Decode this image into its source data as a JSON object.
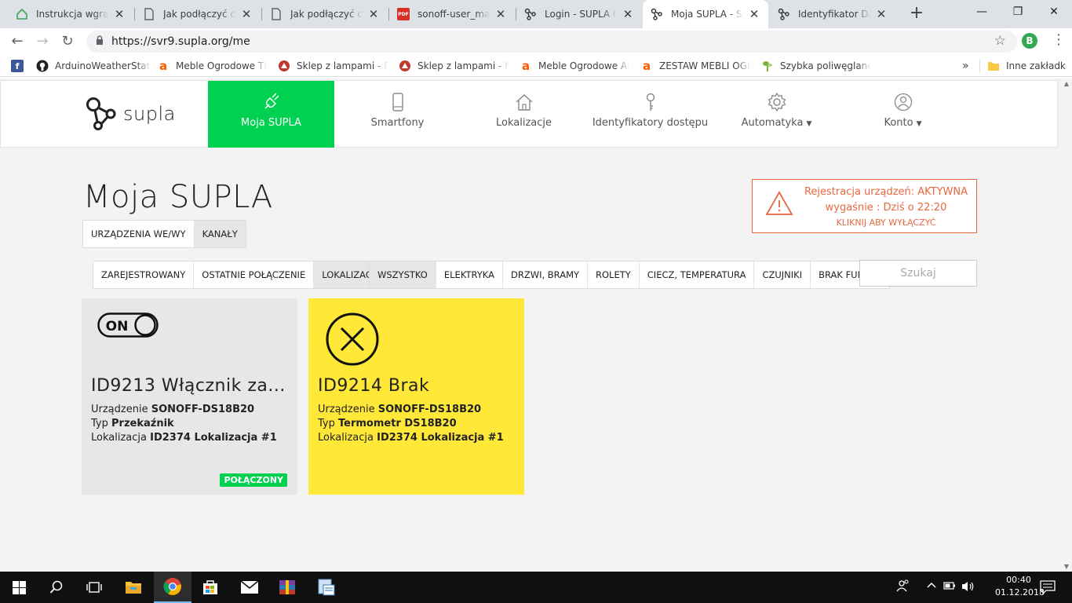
{
  "browser": {
    "tabs": [
      {
        "title": "Instrukcja wgrania",
        "icon": "house-icon"
      },
      {
        "title": "Jak podłączyć czuj",
        "icon": "page-icon"
      },
      {
        "title": "Jak podłączyć czuj",
        "icon": "page-icon"
      },
      {
        "title": "sonoff-user_manu",
        "icon": "pdf-icon"
      },
      {
        "title": "Login - SUPLA Clo",
        "icon": "supla-icon"
      },
      {
        "title": "Moja SUPLA - SUP",
        "icon": "supla-icon",
        "active": true
      },
      {
        "title": "Identyfikator Dost",
        "icon": "supla-icon"
      }
    ],
    "pdf_badge": "PDF",
    "url": "https://svr9.supla.org/me",
    "profile_initial": "B",
    "bookmarks": [
      {
        "title": "",
        "icon": "facebook-icon",
        "color": "#3b5998",
        "glyph": "f"
      },
      {
        "title": "ArduinoWeatherStati",
        "icon": "github-icon",
        "color": "#222",
        "glyph": ""
      },
      {
        "title": "Meble Ogrodowe TE",
        "icon": "allegro-icon",
        "color": "#ff5a00",
        "glyph": "a"
      },
      {
        "title": "Sklep z lampami - RE",
        "icon": "lamp-shop-icon",
        "color": "#c0392b",
        "glyph": ""
      },
      {
        "title": "Sklep z lampami - M",
        "icon": "lamp-shop-icon",
        "color": "#c0392b",
        "glyph": ""
      },
      {
        "title": "Meble Ogrodowe Alu",
        "icon": "allegro-icon",
        "color": "#ff5a00",
        "glyph": "a"
      },
      {
        "title": "ZESTAW MEBLI OGRO",
        "icon": "allegro-icon",
        "color": "#ff5a00",
        "glyph": "a"
      },
      {
        "title": "Szybka poliwęglanow",
        "icon": "plant-icon",
        "color": "#7cb342",
        "glyph": ""
      }
    ],
    "bookmarks_more": "»",
    "other_bookmarks": "Inne zakładki"
  },
  "app": {
    "brand": "supla",
    "nav": [
      {
        "label": "Moja SUPLA",
        "icon": "plug-icon",
        "active": true
      },
      {
        "label": "Smartfony",
        "icon": "smartphone-icon"
      },
      {
        "label": "Lokalizacje",
        "icon": "home-icon"
      },
      {
        "label": "Identyfikatory dostępu",
        "icon": "key-icon"
      },
      {
        "label": "Automatyka",
        "icon": "gear-icon",
        "dropdown": true
      },
      {
        "label": "Konto",
        "icon": "user-icon",
        "dropdown": true
      }
    ],
    "page_title": "Moja SUPLA",
    "view_tabs": [
      {
        "label": "URZĄDZENIA WE/WY",
        "active": false
      },
      {
        "label": "KANAŁY",
        "active": true
      }
    ],
    "warning": {
      "line1": "Rejestracja urządzeń: AKTYWNA",
      "line2": "wygaśnie : Dziś o 22:20",
      "action": "KLIKNIJ ABY WYŁĄCZYĆ",
      "color": "#e8673f"
    },
    "sort_tabs": [
      {
        "label": "ZAREJESTROWANY",
        "active": false
      },
      {
        "label": "OSTATNIE POŁĄCZENIE",
        "active": false
      },
      {
        "label": "LOKALIZACJA",
        "active": true
      }
    ],
    "filter_tabs": [
      {
        "label": "WSZYSTKO",
        "active": true
      },
      {
        "label": "ELEKTRYKA",
        "active": false
      },
      {
        "label": "DRZWI, BRAMY",
        "active": false
      },
      {
        "label": "ROLETY",
        "active": false
      },
      {
        "label": "CIECZ, TEMPERATURA",
        "active": false
      },
      {
        "label": "CZUJNIKI",
        "active": false
      },
      {
        "label": "BRAK FUNKCJI",
        "active": false
      }
    ],
    "search_placeholder": "Szukaj",
    "channels": [
      {
        "title": "ID9213 Włącznik za...",
        "icon": "on-switch-icon",
        "switch_text": "ON",
        "device_label": "Urządzenie",
        "device": "SONOFF-DS18B20",
        "type_label": "Typ",
        "type": "Przekaźnik",
        "location_label": "Lokalizacja",
        "location": "ID2374 Lokalizacja #1",
        "status": "POŁĄCZONY",
        "bg": "#e7e7e7"
      },
      {
        "title": "ID9214 Brak",
        "icon": "x-circle-icon",
        "device_label": "Urządzenie",
        "device": "SONOFF-DS18B20",
        "type_label": "Typ",
        "type": "Termometr DS18B20",
        "location_label": "Lokalizacja",
        "location": "ID2374 Lokalizacja #1",
        "bg": "#ffe838"
      }
    ],
    "accent_color": "#00d151"
  },
  "taskbar": {
    "time": "00:40",
    "date": "01.12.2018",
    "apps": [
      "start-icon",
      "search-icon",
      "task-view-icon",
      "file-explorer-icon",
      "chrome-icon",
      "store-icon",
      "mail-icon",
      "winrar-icon",
      "app-icon"
    ]
  }
}
